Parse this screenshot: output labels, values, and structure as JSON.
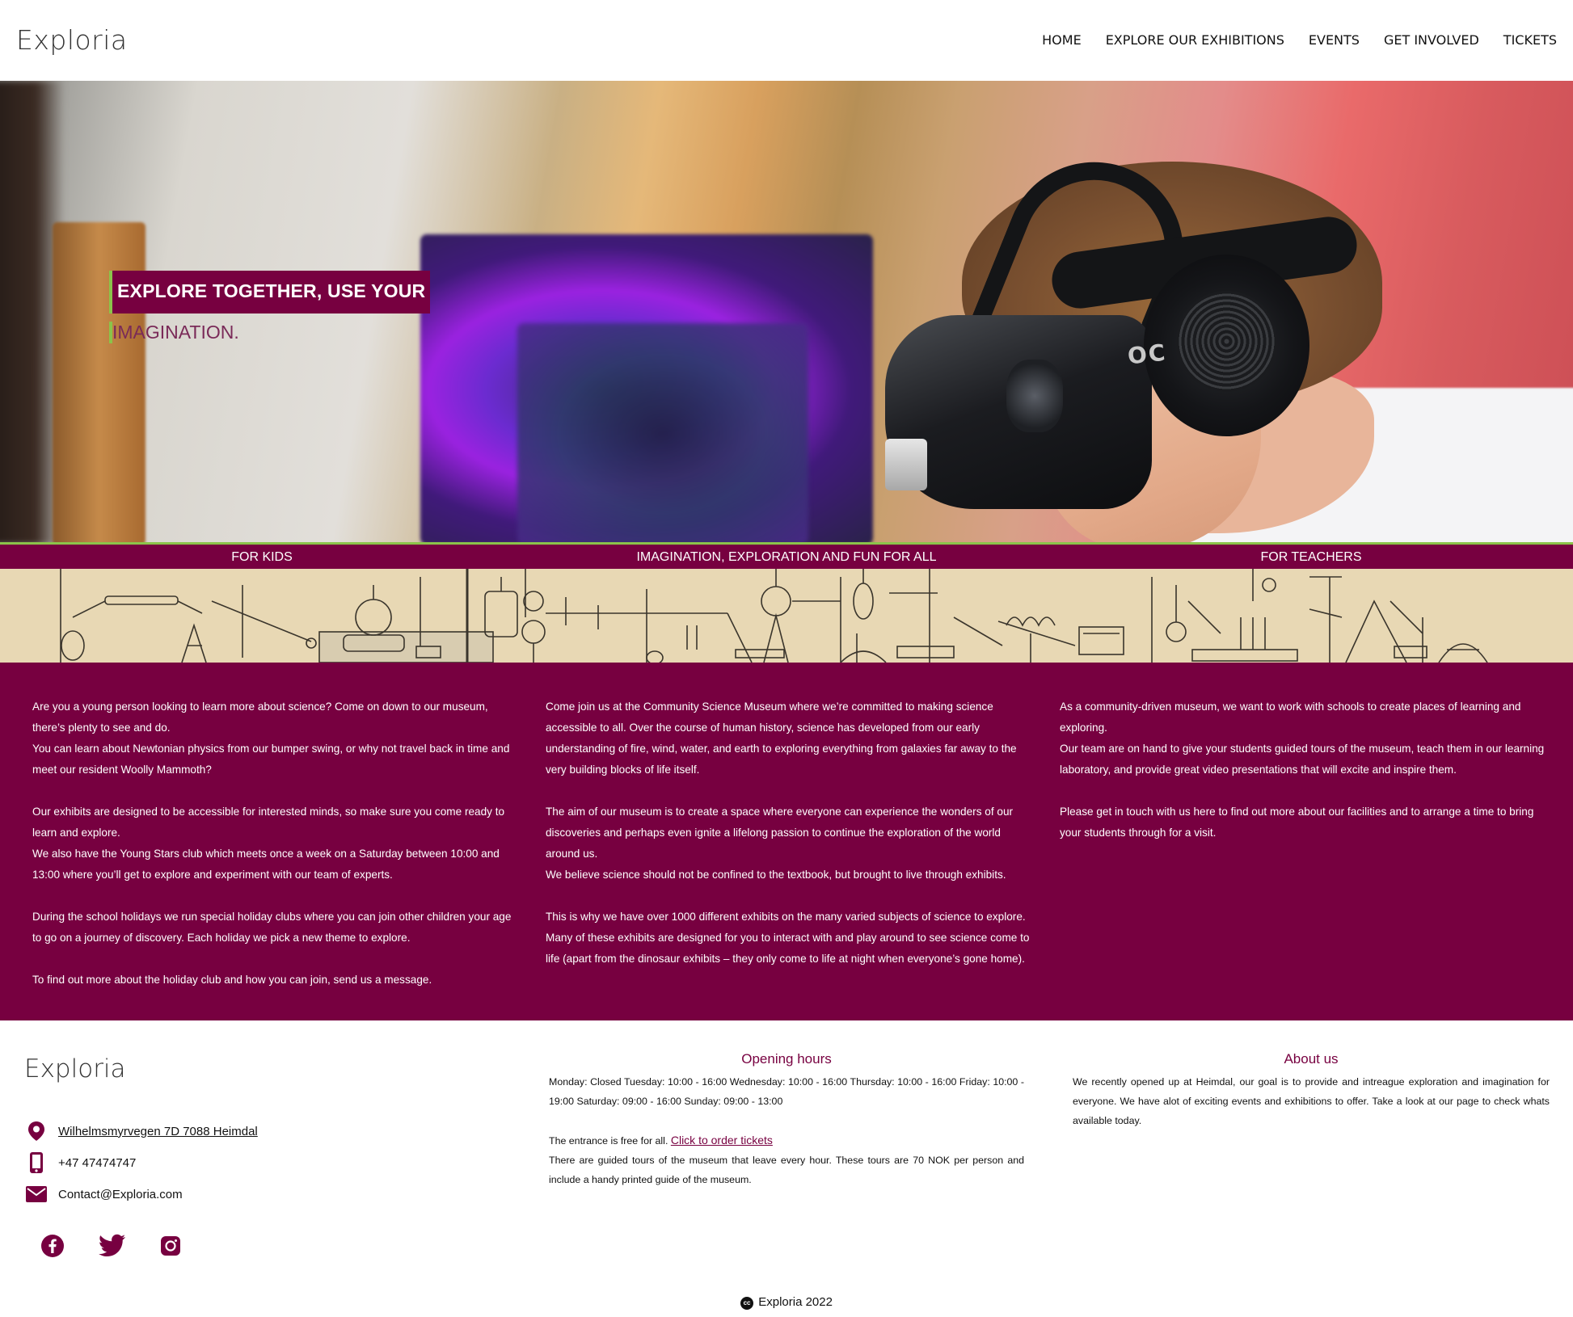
{
  "header": {
    "brand": "Exploria",
    "nav": [
      {
        "label": "HOME"
      },
      {
        "label": "EXPLORE OUR EXHIBITIONS"
      },
      {
        "label": "EVENTS"
      },
      {
        "label": "GET INVOLVED"
      },
      {
        "label": "TICKETS"
      }
    ]
  },
  "hero": {
    "title": "EXPLORE TOGETHER, USE YOUR",
    "subtitle": "IMAGINATION.",
    "image_alt": "headset-brand-text",
    "image_text": "OC"
  },
  "sections": {
    "labels": [
      "FOR KIDS",
      "IMAGINATION, EXPLORATION AND FUN FOR ALL",
      "FOR TEACHERS"
    ]
  },
  "columns": [
    {
      "paragraphs": [
        "Are you a young person looking to learn more about science? Come on down to our museum, there’s plenty to see and do.",
        "You can learn about Newtonian physics from our bumper swing, or why not travel back in time and meet our resident Woolly Mammoth?",
        "",
        "Our exhibits are designed to be accessible for interested minds, so make sure you come ready to learn and explore.",
        "We also have the Young Stars club which meets once a week on a Saturday between 10:00 and 13:00 where you’ll get to explore and experiment with our team of experts.",
        "",
        "During the school holidays we run special holiday clubs where you can join other children your age to go on a journey of discovery. Each holiday we pick a new theme to explore.",
        "",
        "To find out more about the holiday club and how you can join, send us a message."
      ]
    },
    {
      "paragraphs": [
        "Come join us at the Community Science Museum where we’re committed to making science accessible to all. Over the course of human history, science has developed from our early understanding of fire, wind, water, and earth to exploring everything from galaxies far away to the very building blocks of life itself.",
        "",
        "The aim of our museum is to create a space where everyone can experience the wonders of our discoveries and perhaps even ignite a lifelong passion to continue the exploration of the world around us.",
        "We believe science should not be confined to the textbook, but brought to live through exhibits.",
        "",
        "This is why we have over 1000 different exhibits on the many varied subjects of science to explore. Many of these exhibits are designed for you to interact with and play around to see science come to life (apart from the dinosaur exhibits – they only come to life at night when everyone’s gone home)."
      ]
    },
    {
      "paragraphs": [
        "As a community-driven museum, we want to work with schools to create places of learning and exploring.",
        "Our team are on hand to give your students guided tours of the museum, teach them in our learning laboratory, and provide great video presentations that will excite and inspire them.",
        "",
        "Please get in touch with us here to find out more about our facilities and to arrange a time to bring your students through for a visit."
      ]
    }
  ],
  "footer": {
    "brand": "Exploria",
    "address": "Wilhelmsmyrvegen 7D 7088 Heimdal",
    "phone": "+47 47474747",
    "email": "Contact@Exploria.com",
    "opening_heading": "Opening hours",
    "opening_text": "Monday: Closed Tuesday: 10:00 - 16:00 Wednesday: 10:00 - 16:00 Thursday: 10:00 - 16:00 Friday: 10:00 - 19:00 Saturday: 09:00 - 16:00 Sunday: 09:00 - 13:00",
    "entrance_text": "The entrance is free for all.",
    "tickets_link": "Click to order tickets",
    "tours_text": "There are guided tours of the museum that leave every hour. These tours are 70 NOK per person and include a handy printed guide of the museum.",
    "about_heading": "About us",
    "about_text": "We recently opened up at Heimdal, our goal is to provide and intreague exploration and imagination for everyone. We have alot of exciting events and exhibitions to offer. Take a look at our page to check whats available today.",
    "cc_mark": "cc",
    "copyright": "Exploria 2022"
  },
  "colors": {
    "brand": "#770040",
    "accent_green": "#8bc34a",
    "strip_bg": "#e8d8b4"
  },
  "icons": {
    "address": "location-pin-icon",
    "phone": "smartphone-icon",
    "email": "envelope-icon",
    "social": [
      "facebook-icon",
      "twitter-icon",
      "instagram-icon"
    ]
  }
}
